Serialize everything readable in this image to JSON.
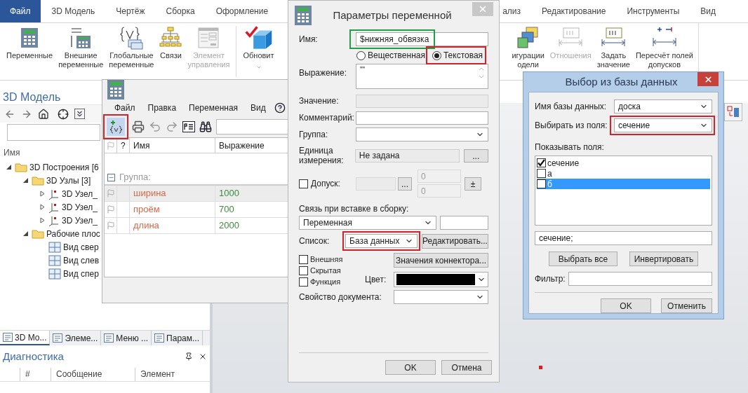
{
  "ribbon": {
    "tabs_left": [
      {
        "label": "Файл",
        "selected": true
      },
      {
        "label": "3D Модель",
        "selected": false
      },
      {
        "label": "Чертёж",
        "selected": false
      },
      {
        "label": "Сборка",
        "selected": false
      },
      {
        "label": "Оформление",
        "selected": false
      }
    ],
    "tabs_right": [
      {
        "label": "ализ",
        "selected": false
      },
      {
        "label": "Редактирование",
        "selected": false
      },
      {
        "label": "Инструменты",
        "selected": false
      },
      {
        "label": "Вид",
        "selected": false
      }
    ],
    "commands_left": [
      {
        "lines": [
          "Переменные"
        ],
        "disabled": false
      },
      {
        "lines": [
          "Внешние",
          "переменные"
        ],
        "disabled": false
      },
      {
        "lines": [
          "Глобальные",
          "переменные"
        ],
        "disabled": false
      },
      {
        "lines": [
          "Связи"
        ],
        "disabled": false
      },
      {
        "lines": [
          "Элемент",
          "управления"
        ],
        "disabled": true
      },
      {
        "lines": [
          "Обновит"
        ],
        "disabled": false,
        "dropdown": true
      }
    ],
    "commands_right": [
      {
        "lines": [
          "игурации",
          "одели"
        ],
        "disabled": false
      },
      {
        "lines": [
          "Отношения"
        ],
        "disabled": true
      },
      {
        "lines": [
          "Задать",
          "значение"
        ],
        "disabled": false
      },
      {
        "lines": [
          "Пересчёт полей",
          "допусков"
        ],
        "disabled": false
      }
    ]
  },
  "model_panel": {
    "title": "3D Модель",
    "column": "Имя",
    "tree": [
      {
        "label": "3D Построения [6",
        "kind": "folder",
        "expanded": true,
        "children": [
          {
            "label": "3D Узлы [3]",
            "kind": "folder",
            "expanded": true,
            "children": [
              {
                "label": "3D Узел_",
                "kind": "node",
                "expanded": false
              },
              {
                "label": "3D Узел_",
                "kind": "node",
                "expanded": false
              },
              {
                "label": "3D Узел_",
                "kind": "node",
                "expanded": false
              }
            ]
          },
          {
            "label": "Рабочие плос",
            "kind": "folder",
            "expanded": true,
            "children": [
              {
                "label": "Вид свер",
                "kind": "view"
              },
              {
                "label": "Вид слев",
                "kind": "view"
              },
              {
                "label": "Вид спер",
                "kind": "view"
              }
            ]
          }
        ]
      }
    ],
    "tabs": [
      {
        "label": "3D Мо...",
        "selected": true
      },
      {
        "label": "Элеме...",
        "selected": false
      },
      {
        "label": "Меню ...",
        "selected": false
      },
      {
        "label": "Парам...",
        "selected": false
      }
    ]
  },
  "diagnostics": {
    "title": "Диагностика",
    "columns": [
      "#",
      "Сообщение",
      "Элемент"
    ]
  },
  "variables_window": {
    "menu": [
      "Файл",
      "Правка",
      "Переменная",
      "Вид"
    ],
    "add_highlight": {
      "color": "#d0232b"
    },
    "columns": [
      "?",
      "Имя",
      "Выражение"
    ],
    "group": "Группа:",
    "rows": [
      {
        "name": "ширина",
        "expression": "1000",
        "selected": true
      },
      {
        "name": "проём",
        "expression": "700",
        "selected": false
      },
      {
        "name": "длина",
        "expression": "2000",
        "selected": false
      }
    ]
  },
  "param_dialog": {
    "title": "Параметры переменной",
    "name_label": "Имя:",
    "name": "$нижняя_обвязка",
    "name_highlight": {
      "color": "#1fa046"
    },
    "types": [
      {
        "label": "Вещественная",
        "selected": false
      },
      {
        "label": "Текстовая",
        "selected": true,
        "highlight": {
          "color": "#d0232b"
        }
      }
    ],
    "expression_label": "Выражение:",
    "expression": "\"\"",
    "value_label": "Значение:",
    "comment_label": "Комментарий:",
    "group_label": "Группа:",
    "unit_label": "Единица измерения:",
    "unit": "Не задана",
    "unit_button": "...",
    "tolerance": {
      "label": "Допуск:",
      "checked": false,
      "button": "...",
      "upper": "0",
      "lower": "0",
      "sign_button": "±"
    },
    "link_label": "Связь при вставке в сборку:",
    "link": "Переменная",
    "list_label": "Список:",
    "list": "База данных",
    "list_highlight": {
      "color": "#d0232b"
    },
    "edit_button": "Редактировать...",
    "flags": [
      {
        "label": "Внешняя",
        "checked": false
      },
      {
        "label": "Скрытая",
        "checked": false
      },
      {
        "label": "Функция",
        "checked": false
      }
    ],
    "connector_button": "Значения коннектора...",
    "color_label": "Цвет:",
    "color": "#000000",
    "doc_property_label": "Свойство документа:",
    "ok": "OK",
    "cancel": "Отмена"
  },
  "db_dialog": {
    "title": "Выбор из базы данных",
    "db_label": "Имя базы данных:",
    "db": "доска",
    "field_label": "Выбирать из поля:",
    "field": "сечение",
    "field_highlight": {
      "color": "#d0232b"
    },
    "show_label": "Показывать поля:",
    "fields": [
      {
        "label": "сечение",
        "checked": true,
        "selected": false
      },
      {
        "label": "а",
        "checked": false,
        "selected": false
      },
      {
        "label": "б",
        "checked": false,
        "selected": true
      }
    ],
    "summary": "сечение;",
    "select_all": "Выбрать все",
    "invert": "Инвертировать",
    "filter_label": "Фильтр:",
    "ok": "OK",
    "cancel": "Отменить"
  }
}
